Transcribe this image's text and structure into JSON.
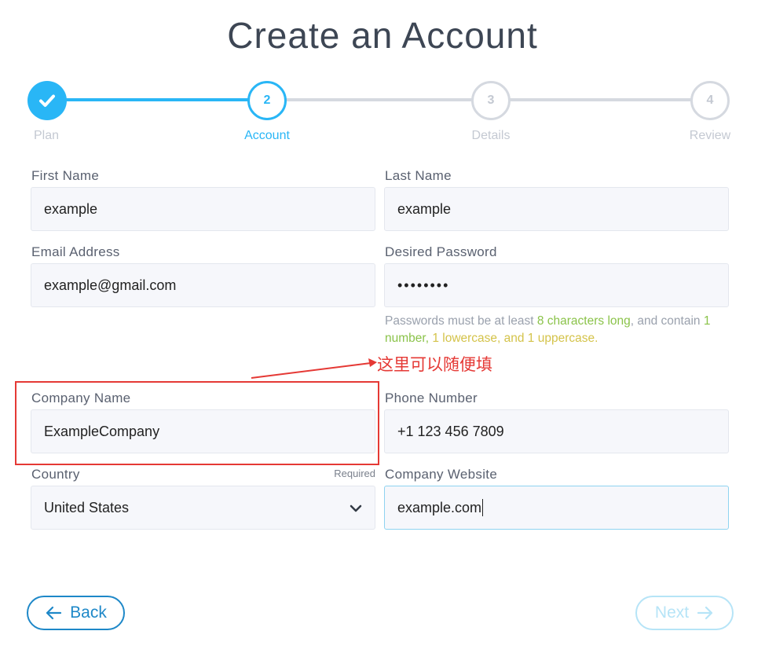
{
  "page": {
    "title": "Create an Account"
  },
  "stepper": {
    "steps": [
      {
        "number": "",
        "label": "Plan",
        "state": "complete"
      },
      {
        "number": "2",
        "label": "Account",
        "state": "active"
      },
      {
        "number": "3",
        "label": "Details",
        "state": "pending"
      },
      {
        "number": "4",
        "label": "Review",
        "state": "pending"
      }
    ]
  },
  "form": {
    "first_name": {
      "label": "First Name",
      "value": "example"
    },
    "last_name": {
      "label": "Last Name",
      "value": "example"
    },
    "email": {
      "label": "Email Address",
      "value": "example@gmail.com"
    },
    "password": {
      "label": "Desired Password",
      "value": "••••••••"
    },
    "password_hint": {
      "prefix": "Passwords must be at least ",
      "length_req": "8 characters long",
      "mid": ", and contain ",
      "number_req": "1 number,",
      "case_req": " 1 lowercase, and 1 uppercase",
      "suffix": "."
    },
    "company_name": {
      "label": "Company Name",
      "value": "ExampleCompany"
    },
    "phone": {
      "label": "Phone Number",
      "value": "+1 123 456 7809"
    },
    "country": {
      "label": "Country",
      "required_text": "Required",
      "selected": "United States"
    },
    "website": {
      "label": "Company Website",
      "value": "example.com"
    }
  },
  "annotation": {
    "text": "这里可以随便填",
    "color": "#e53935"
  },
  "buttons": {
    "back": "Back",
    "next": "Next"
  },
  "colors": {
    "accent": "#29b6f6",
    "accent_dark": "#1e88c8",
    "inactive": "#d5d9e0"
  }
}
